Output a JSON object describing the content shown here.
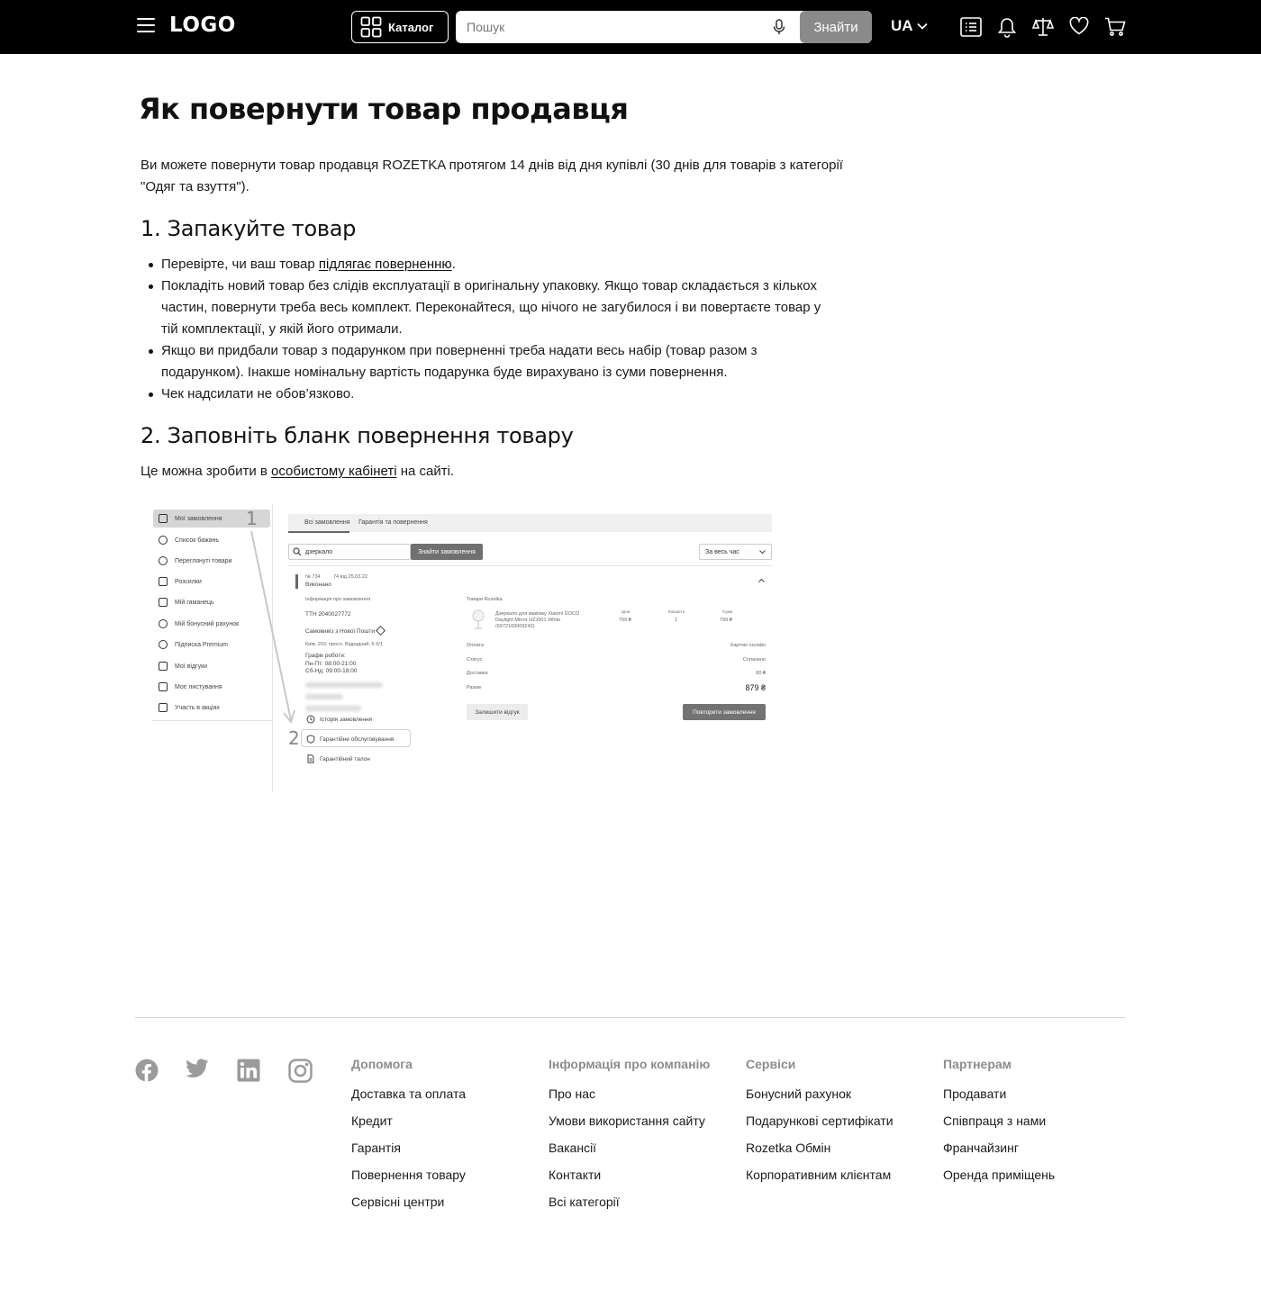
{
  "header": {
    "logo": "LOGO",
    "catalog_label": "Каталог",
    "search_placeholder": "Пошук",
    "search_button": "Знайти",
    "language": "UA"
  },
  "article": {
    "title": "Як повернути товар продавця",
    "intro": "Ви можете повернути товар продавця ROZETKA протягом 14 днів від дня купівлі (30 днів для товарів з категорії \"Одяг та взуття\").",
    "step1_title": "1. Запакуйте товар",
    "step1_items": {
      "i0_before": "Перевірте, чи ваш товар ",
      "i0_link": "підлягає поверненню",
      "i0_after": ".",
      "i1": "Покладіть новий товар без слідів експлуатації в оригінальну упаковку. Якщо товар складається з кількох частин, повернути треба весь комплект. Переконайтеся, що нічого не загубилося і ви повертаєте товар у тій комплектації, у якій його отримали.",
      "i2": "Якщо ви придбали товар з подарунком при поверненні треба надати весь набір (товар разом з подарунком). Інакше номінальну вартість подарунка буде вирахувано із суми повернення.",
      "i3": "Чек надсилати не обов’язково."
    },
    "step2_title": "2. Заповніть бланк повернення товару",
    "step2_before": "Це можна зробити в ",
    "step2_link": "особистому кабінеті",
    "step2_after": " на сайті."
  },
  "illustration": {
    "sidebar": [
      "Мої замовлення",
      "Список бажань",
      "Переглянуті товари",
      "Розсилки",
      "Мій гаманець",
      "Мій бонусний рахунок",
      "Підписка Premium",
      "Мої відгуки",
      "Моє листування",
      "Участь в акціях"
    ],
    "marker_1": "1",
    "marker_2": "2",
    "tabs": [
      "Всі замовлення",
      "Гарантія та повернення"
    ],
    "search_value": "дзеркало",
    "find_orders_button": "Знайти замовлення",
    "period_select": "За весь час",
    "order_number": "№ 734",
    "order_date": "74 від 25.03.22",
    "order_status": "Виконано",
    "order_info_label": "Інформація про замовлення",
    "ttn": "ТТН 2040027772",
    "delivery": "Самовивіз з Нової Пошти",
    "address": "Київ, 203, просп. Відрадний, 6 б/1",
    "schedule_label": "Графік роботи:",
    "schedule_weekdays": "Пн-Пт: 08:00-21:00",
    "schedule_weekend": "Сб-Нд: 09:00-18:00",
    "history_link": "Історія замовлення",
    "warranty_service": "Гарантійне обслуговування",
    "warranty_card": "Гарантійний талон",
    "goods_label": "Товари Rozetka",
    "product_line1": "Дзеркало для макіяжу Xiaomi DOCO",
    "product_line2": "Daylight Mirror HZJ001 White",
    "product_line3": "(6972169009242)",
    "price_header": "Ціна",
    "qty_header": "Кількість",
    "sum_header": "Сума",
    "price": "799 ₴",
    "qty": "1",
    "sum": "799 ₴",
    "payment_label": "Оплата",
    "payment_value": "Картою онлайн",
    "status_label": "Статус",
    "status_value": "Сплачено",
    "delivery_label": "Доставка",
    "delivery_value": "80 ₴",
    "total_label": "Разом",
    "total_value": "879 ₴",
    "review_button": "Залишити відгук",
    "repeat_button": "Повторити замовлення"
  },
  "footer": {
    "social": [
      "facebook-icon",
      "twitter-icon",
      "linkedin-icon",
      "instagram-icon"
    ],
    "columns": [
      {
        "title": "Допомога",
        "items": [
          "Доставка та оплата",
          "Кредит",
          "Гарантія",
          "Повернення товару",
          "Сервісні центри"
        ]
      },
      {
        "title": "Інформація про компанію",
        "items": [
          "Про нас",
          "Умови використання сайту",
          "Вакансії",
          "Контакти",
          "Всі категорії"
        ]
      },
      {
        "title": "Сервіси",
        "items": [
          "Бонусний рахунок",
          "Подарункові сертифікати",
          "Rozetka Обмін",
          "Корпоративним клієнтам"
        ]
      },
      {
        "title": "Партнерам",
        "items": [
          "Продавати",
          "Співпраця з нами",
          "Франчайзинг",
          "Оренда приміщень"
        ]
      }
    ]
  }
}
